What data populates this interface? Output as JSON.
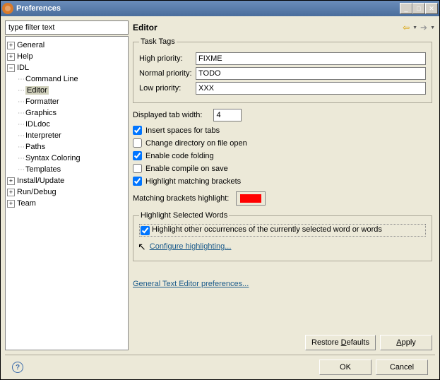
{
  "window": {
    "title": "Preferences"
  },
  "filter": {
    "placeholder": "type filter text"
  },
  "tree": {
    "general": "General",
    "help": "Help",
    "idl": "IDL",
    "idl_children": {
      "command_line": "Command Line",
      "editor": "Editor",
      "formatter": "Formatter",
      "graphics": "Graphics",
      "idldoc": "IDLdoc",
      "interpreter": "Interpreter",
      "paths": "Paths",
      "syntax_coloring": "Syntax Coloring",
      "templates": "Templates"
    },
    "install_update": "Install/Update",
    "run_debug": "Run/Debug",
    "team": "Team"
  },
  "page": {
    "title": "Editor",
    "task_tags_legend": "Task Tags",
    "high_priority_label": "High priority:",
    "high_priority_value": "FIXME",
    "normal_priority_label": "Normal priority:",
    "normal_priority_value": "TODO",
    "low_priority_label": "Low priority:",
    "low_priority_value": "XXX",
    "tab_width_label": "Displayed tab width:",
    "tab_width_value": "4",
    "insert_spaces": "Insert spaces for tabs",
    "change_dir": "Change directory on file open",
    "code_folding": "Enable code folding",
    "compile_save": "Enable compile on save",
    "highlight_brackets": "Highlight matching brackets",
    "matching_color_label": "Matching brackets highlight:",
    "matching_color": "#ff0000",
    "hsw_legend": "Highlight Selected Words",
    "hsw_check": "Highlight other occurrences of the currently selected word or words",
    "configure_link": "Configure highlighting...",
    "general_editor_link": "General Text Editor preferences...",
    "restore_defaults": "Restore Defaults",
    "apply": "Apply",
    "ok": "OK",
    "cancel": "Cancel"
  }
}
